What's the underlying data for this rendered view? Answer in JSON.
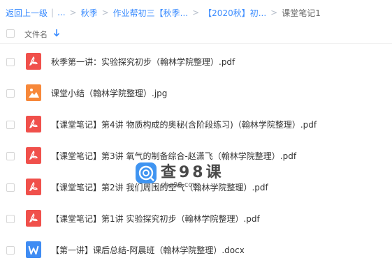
{
  "breadcrumb": {
    "back": "返回上一级",
    "divider": "|",
    "ellipsis": "...",
    "items": [
      "秋季",
      "作业帮初三【秋季...",
      "【2020秋】初...",
      "课堂笔记1"
    ],
    "separator": ">"
  },
  "header": {
    "column_label": "文件名",
    "sort_icon": "arrow-down-icon"
  },
  "files": [
    {
      "name": "秋季第一讲：实验探究初步（翰林学院整理）.pdf",
      "type": "pdf",
      "icon": "pdf-icon"
    },
    {
      "name": "课堂小结（翰林学院整理）.jpg",
      "type": "image",
      "icon": "image-icon"
    },
    {
      "name": "【课堂笔记】第4讲 物质构成的奥秘(含阶段练习)（翰林学院整理）.pdf",
      "type": "pdf",
      "icon": "pdf-icon"
    },
    {
      "name": "【课堂笔记】第3讲 氧气的制备综合-赵潇飞（翰林学院整理）.pdf",
      "type": "pdf",
      "icon": "pdf-icon"
    },
    {
      "name": "【课堂笔记】第2讲 我们周围的空气（翰林学院整理）.pdf",
      "type": "pdf",
      "icon": "pdf-icon"
    },
    {
      "name": "【课堂笔记】第1讲 实验探究初步（翰林学院整理）.pdf",
      "type": "pdf",
      "icon": "pdf-icon"
    },
    {
      "name": "【第一讲】课后总结-阿晨班（翰林学院整理）.docx",
      "type": "word",
      "icon": "word-icon"
    }
  ],
  "watermark": {
    "title": "查98课",
    "subtitle": "cha98.com"
  },
  "colors": {
    "link": "#3b8cff",
    "pdf": "#f0504b",
    "image": "#f7883a",
    "word": "#3f8cf3",
    "watermark_logo": "#2f8cf0"
  }
}
